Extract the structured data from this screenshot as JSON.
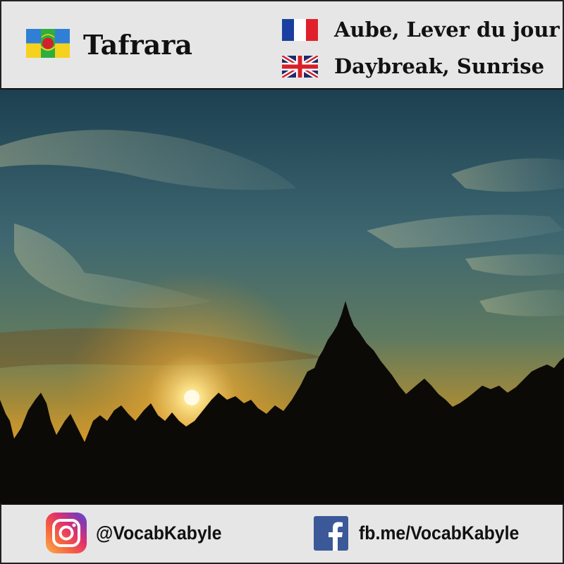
{
  "header": {
    "word": "Tafrara",
    "translations": [
      {
        "language": "French",
        "flag_icon": "france-flag-icon",
        "text": "Aube, Lever du jour"
      },
      {
        "language": "English",
        "flag_icon": "uk-flag-icon",
        "text": "Daybreak, Sunrise"
      }
    ],
    "word_flag_icon": "kabyle-flag-icon"
  },
  "photo": {
    "subject": "sunrise over silhouetted treeline",
    "colors": {
      "sky_top": "#1f4a58",
      "sky_mid": "#4c7468",
      "horizon": "#e6a52a",
      "sun": "#fff6c8",
      "trees": "#0b0a06"
    }
  },
  "footer": {
    "instagram": {
      "icon": "instagram-icon",
      "handle": "@VocabKabyle"
    },
    "facebook": {
      "icon": "facebook-icon",
      "handle": "fb.me/VocabKabyle"
    }
  }
}
